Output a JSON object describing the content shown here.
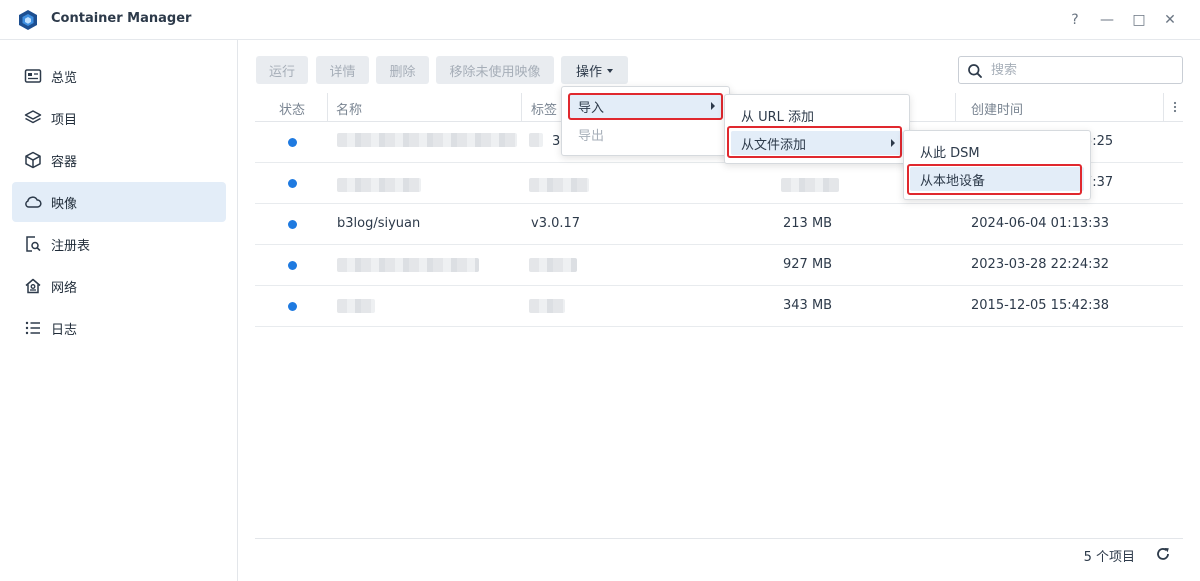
{
  "window": {
    "title": "Container Manager",
    "controls": [
      "?",
      "—",
      "□",
      "✕"
    ]
  },
  "sidebar": {
    "items": [
      {
        "label": "总览",
        "icon": "dashboard-icon"
      },
      {
        "label": "项目",
        "icon": "layers-icon"
      },
      {
        "label": "容器",
        "icon": "cube-icon"
      },
      {
        "label": "映像",
        "icon": "cloud-icon"
      },
      {
        "label": "注册表",
        "icon": "registry-search-icon"
      },
      {
        "label": "网络",
        "icon": "network-home-icon"
      },
      {
        "label": "日志",
        "icon": "list-icon"
      }
    ],
    "active": "映像"
  },
  "toolbar": {
    "run": "运行",
    "details": "详情",
    "delete": "删除",
    "remove_unused": "移除未使用映像",
    "actions": "操作"
  },
  "search": {
    "placeholder": "搜索"
  },
  "table": {
    "headers": {
      "status": "状态",
      "name": "名称",
      "tag": "标签",
      "created": "创建时间"
    },
    "rows": [
      {
        "name": "",
        "tag": "3",
        "size": "",
        "created": "5:25"
      },
      {
        "name": "",
        "tag": "",
        "size": "",
        "created": "7:37"
      },
      {
        "name": "b3log/siyuan",
        "tag": "v3.0.17",
        "size": "213 MB",
        "created": "2024-06-04 01:13:33"
      },
      {
        "name": "",
        "tag": "",
        "size": "927 MB",
        "created": "2023-03-28 22:24:32"
      },
      {
        "name": "",
        "tag": "",
        "size": "343 MB",
        "created": "2015-12-05 15:42:38"
      }
    ]
  },
  "footer": {
    "count": "5 个项目"
  },
  "menus": {
    "actions": {
      "import": "导入",
      "export": "导出"
    },
    "import_sub": {
      "from_url": "从 URL 添加",
      "from_file": "从文件添加"
    },
    "file_sub": {
      "from_dsm": "从此 DSM",
      "from_local": "从本地设备"
    }
  },
  "colors": {
    "accent": "#1f7ae0",
    "highlight": "#e3edf8",
    "annotation": "#e0282e"
  }
}
